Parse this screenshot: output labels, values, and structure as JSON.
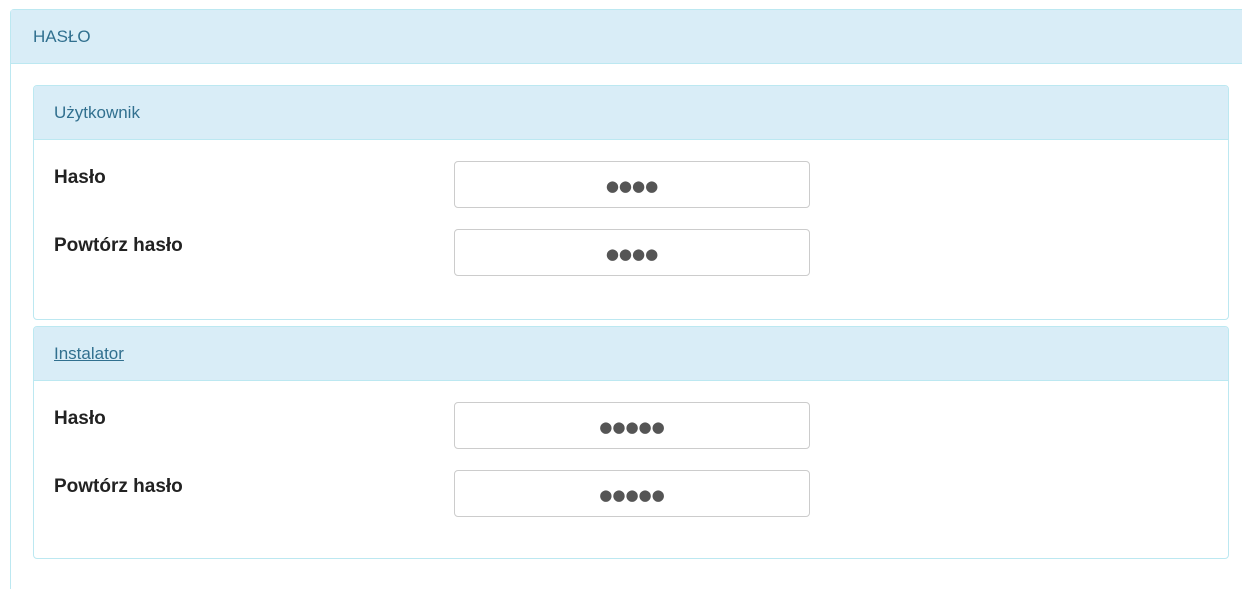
{
  "panel": {
    "title": "HASŁO"
  },
  "sections": [
    {
      "heading": "Użytkownik",
      "fields": [
        {
          "label": "Hasło",
          "value": "●●●●"
        },
        {
          "label": "Powtórz hasło",
          "value": "●●●●"
        }
      ]
    },
    {
      "heading": "Instalator",
      "fields": [
        {
          "label": "Hasło",
          "value": "●●●●●"
        },
        {
          "label": "Powtórz hasło",
          "value": "●●●●●"
        }
      ]
    }
  ]
}
